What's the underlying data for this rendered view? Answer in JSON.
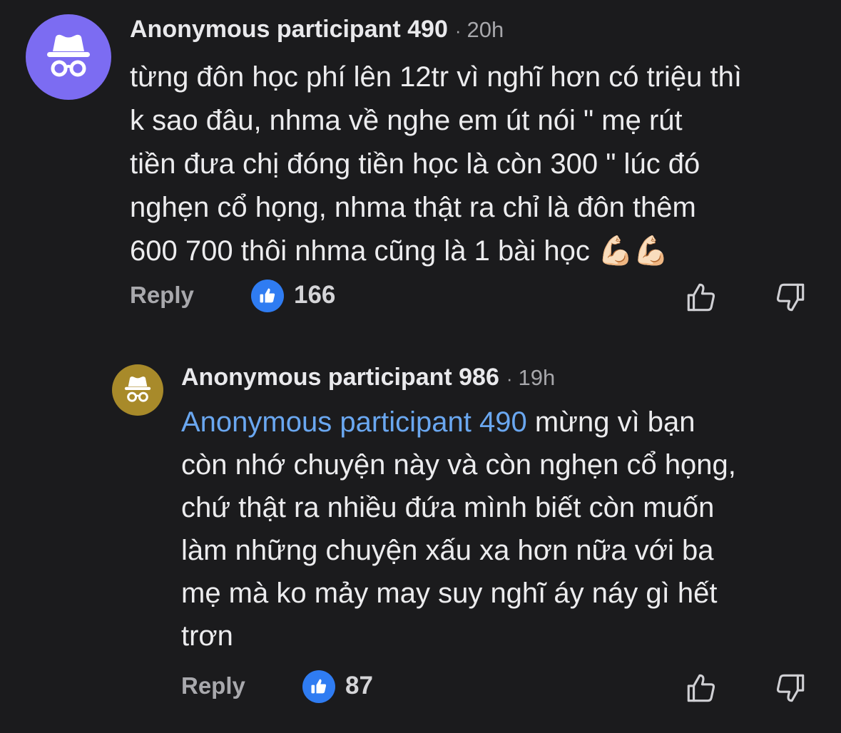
{
  "comments": [
    {
      "author": "Anonymous participant 490",
      "separator": "·",
      "time": "20h",
      "lines": [
        "từng đôn học phí lên 12tr vì nghĩ hơn có triệu thì",
        "k sao đâu, nhma về nghe em út nói \" mẹ rút",
        "tiền đưa chị đóng tiền học là còn 300 \" lúc đó",
        "nghẹn cổ họng, nhma thật ra chỉ là đôn thêm",
        "600 700 thôi nhma cũng là 1 bài học 💪🏻💪🏻"
      ],
      "reply_label": "Reply",
      "like_count": "166",
      "avatar_color": "#7c6cf2",
      "avatar_icon": "incognito-icon"
    },
    {
      "author": "Anonymous participant 986",
      "separator": "·",
      "time": "19h",
      "mention": "Anonymous participant 490",
      "lines": [
        " mừng vì bạn",
        "còn nhớ chuyện này và còn nghẹn cổ họng,",
        "chứ thật ra nhiều đứa mình biết còn muốn",
        "làm những chuyện xấu xa hơn nữa với ba",
        "mẹ mà ko mảy may suy nghĩ áy náy gì hết",
        "trơn"
      ],
      "reply_label": "Reply",
      "like_count": "87",
      "avatar_color": "#a88a2a",
      "avatar_icon": "incognito-icon"
    }
  ],
  "colors": {
    "background": "#1b1b1d",
    "mention": "#6aa7f0",
    "like_badge": "#2f7cf2"
  },
  "icons": {
    "like_badge": "thumbs-up-icon",
    "upvote": "thumbs-up-outline-icon",
    "downvote": "thumbs-down-outline-icon"
  }
}
